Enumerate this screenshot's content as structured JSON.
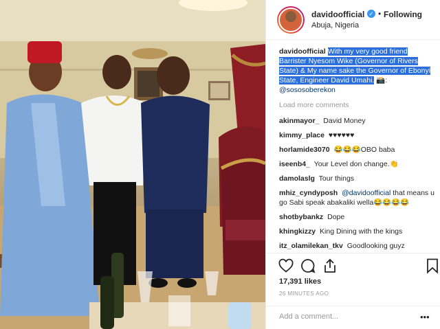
{
  "post": {
    "username": "davidoofficial",
    "follow_state": "Following",
    "location": "Abuja, Nigeria"
  },
  "caption": {
    "username": "davidoofficial",
    "text": "With my very good friend Barrister Nyesom Wike (Governor of Rivers State) & My name sake the Governor of Ebonyi State, Engineer David Umahi.",
    "trailing": "📸:",
    "mention": "@sososoberekon"
  },
  "load_more": "Load more comments",
  "comments": [
    {
      "username": "akinmayor_",
      "text": "David Money"
    },
    {
      "username": "kimmy_place",
      "text": "♥♥♥♥♥♥"
    },
    {
      "username": "horlamide3070",
      "text": "😂😂😂OBO baba"
    },
    {
      "username": "iseenb4_",
      "text": "Your Level don change.👏"
    },
    {
      "username": "damolaslg",
      "text": "Tour things"
    },
    {
      "username": "mhiz_cyndyposh",
      "mention": "@davidoofficial",
      "text": "that means u go Sabi speak abakaliki wella😂😂😂😂"
    },
    {
      "username": "shotbybankz",
      "text": "Dope"
    },
    {
      "username": "khingkizzy",
      "text": "King Dining with the kings"
    },
    {
      "username": "itz_olamilekan_tkv",
      "text": "Goodlooking guyz"
    }
  ],
  "likes": "17,391 likes",
  "time": "26 MINUTES AGO",
  "add_comment_placeholder": "Add a comment...",
  "more_label": "•••",
  "verified_glyph": "✓",
  "colors": {
    "highlight": "#2a6fdb",
    "verified": "#3897f0",
    "mention": "#003569"
  },
  "icons": [
    "heart-icon",
    "comment-icon",
    "share-icon",
    "bookmark-icon"
  ]
}
